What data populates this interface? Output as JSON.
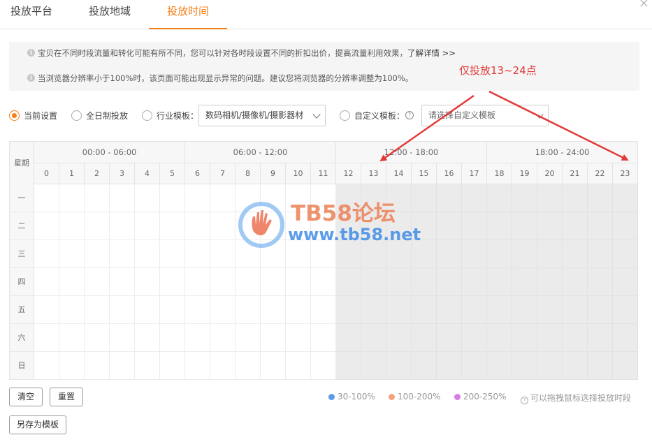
{
  "tabs": [
    {
      "label": "投放平台",
      "active": false
    },
    {
      "label": "投放地域",
      "active": false
    },
    {
      "label": "投放时间",
      "active": true
    }
  ],
  "close_label": "×",
  "notice": {
    "line1": "宝贝在不同时段流量和转化可能有所不同，您可以针对各时段设置不同的折扣出价，提高流量利用效果，",
    "detail_link": "了解详情 >>",
    "line2": "当浏览器分辨率小于100%时，该页面可能出现显示异常的问题。建议您将浏览器的分辨率调整为100%。"
  },
  "annotation": "仅投放13~24点",
  "options": {
    "current": "当前设置",
    "allday": "全日制投放",
    "industry": "行业模板：",
    "industry_value": "数码相机/摄像机/摄影器材",
    "custom": "自定义模板：",
    "custom_placeholder": "请选择自定义模板",
    "selected": "current"
  },
  "schedule": {
    "weekday_header": "星期",
    "ranges": [
      "00:00 - 06:00",
      "06:00 - 12:00",
      "12:00 - 18:00",
      "18:00 - 24:00"
    ],
    "hours": [
      "0",
      "1",
      "2",
      "3",
      "4",
      "5",
      "6",
      "7",
      "8",
      "9",
      "10",
      "11",
      "12",
      "13",
      "14",
      "15",
      "16",
      "17",
      "18",
      "19",
      "20",
      "21",
      "22",
      "23"
    ],
    "days": [
      "一",
      "二",
      "三",
      "四",
      "五",
      "六",
      "日"
    ],
    "active_hours": [
      12,
      13,
      14,
      15,
      16,
      17,
      18,
      19,
      20,
      21,
      22,
      23
    ]
  },
  "buttons": {
    "clear": "清空",
    "reset": "重置",
    "save_template": "另存为模板"
  },
  "legend": [
    {
      "label": "30-100%",
      "color": "#5b9bea"
    },
    {
      "label": "100-200%",
      "color": "#f4a27a"
    },
    {
      "label": "200-250%",
      "color": "#d37ee0"
    }
  ],
  "legend_tip": "可以拖拽鼠标选择投放时段",
  "watermark": {
    "title": "TB58论坛",
    "url": "www.tb58.net"
  },
  "colors": {
    "accent": "#f57f17",
    "annotation": "#e23a3a",
    "active_cell": "#ebebeb"
  }
}
